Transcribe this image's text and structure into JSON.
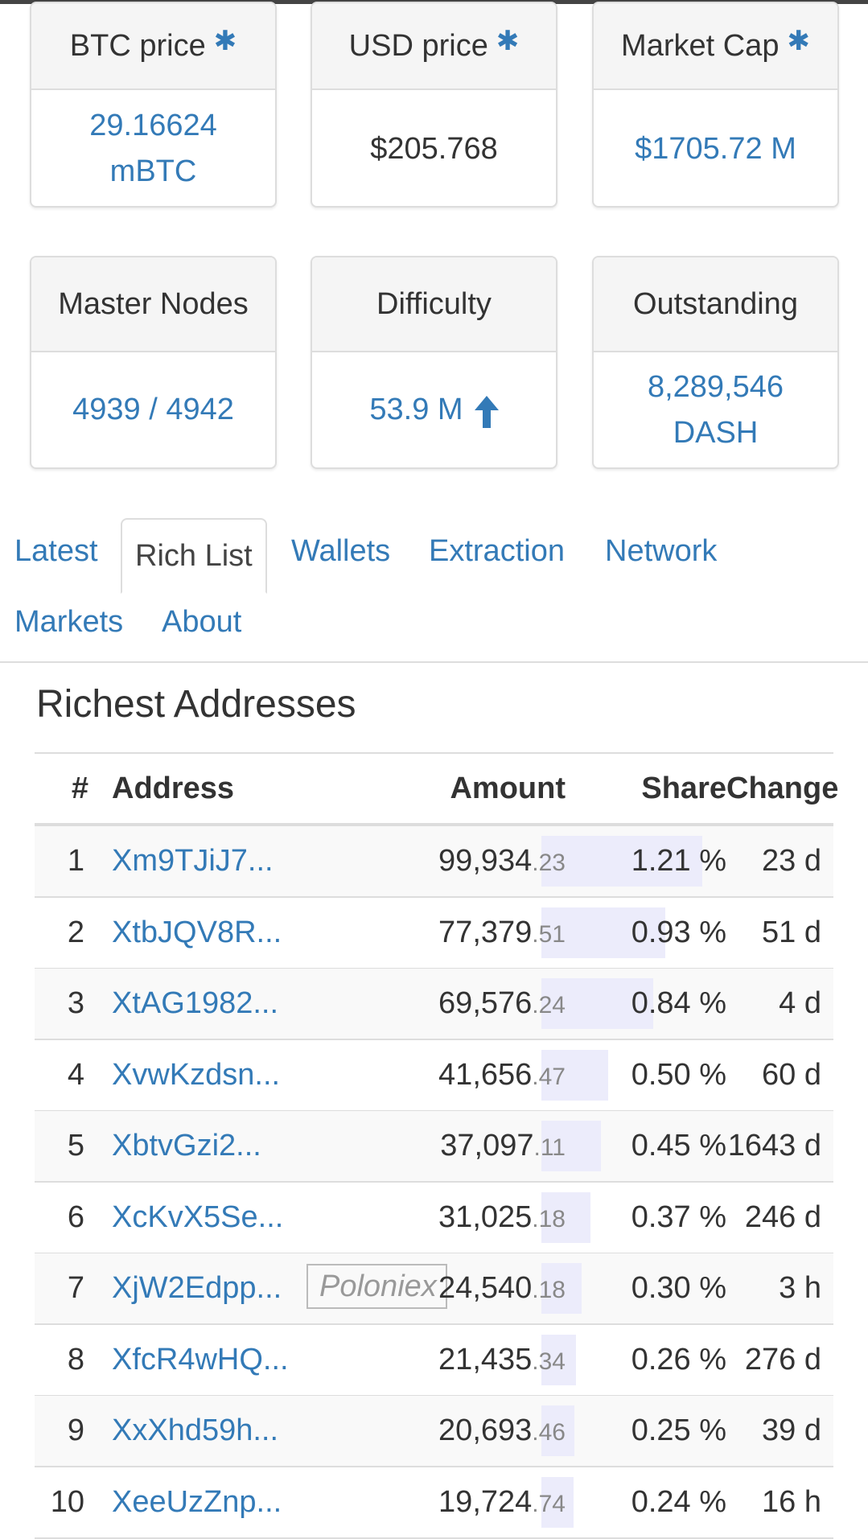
{
  "panels": [
    {
      "title": "BTC price",
      "star": "✱",
      "value": "29.16624\nmBTC",
      "value_line1": "29.16624",
      "value_line2": "mBTC"
    },
    {
      "title": "USD price",
      "star": "✱",
      "value": "$205.768"
    },
    {
      "title": "Market Cap",
      "star": "✱",
      "value": "$1705.72 M"
    },
    {
      "title": "Master Nodes",
      "value": "4939 / 4942"
    },
    {
      "title": "Difficulty",
      "value": "53.9 M",
      "trend_icon": "arrow-up-icon"
    },
    {
      "title": "Outstanding",
      "value_line1": "8,289,546",
      "value_line2": "DASH"
    }
  ],
  "tabs": [
    "Latest",
    "Rich List",
    "Wallets",
    "Extraction",
    "Network",
    "Markets",
    "About"
  ],
  "active_tab": "Rich List",
  "section_title": "Richest Addresses",
  "table": {
    "headers": [
      "#",
      "Address",
      "Amount",
      "Share",
      "Change"
    ],
    "rows": [
      {
        "num": "1",
        "address": "Xm9TJiJ7...",
        "amount_int": "99,934",
        "amount_dec": ".23",
        "share": "1.21 %",
        "share_value": 1.21,
        "change": "23 d"
      },
      {
        "num": "2",
        "address": "XtbJQV8R...",
        "amount_int": "77,379",
        "amount_dec": ".51",
        "share": "0.93 %",
        "share_value": 0.93,
        "change": "51 d"
      },
      {
        "num": "3",
        "address": "XtAG1982...",
        "amount_int": "69,576",
        "amount_dec": ".24",
        "share": "0.84 %",
        "share_value": 0.84,
        "change": "4 d"
      },
      {
        "num": "4",
        "address": "XvwKzdsn...",
        "amount_int": "41,656",
        "amount_dec": ".47",
        "share": "0.50 %",
        "share_value": 0.5,
        "change": "60 d"
      },
      {
        "num": "5",
        "address": "XbtvGzi2...",
        "amount_int": "37,097",
        "amount_dec": ".11",
        "share": "0.45 %",
        "share_value": 0.45,
        "change": "1643 d"
      },
      {
        "num": "6",
        "address": "XcKvX5Se...",
        "amount_int": "31,025",
        "amount_dec": ".18",
        "share": "0.37 %",
        "share_value": 0.37,
        "change": "246 d"
      },
      {
        "num": "7",
        "address": "XjW2Edpp...",
        "tag": "Poloniex",
        "amount_int": "24,540",
        "amount_dec": ".18",
        "share": "0.30 %",
        "share_value": 0.3,
        "change": "3 h"
      },
      {
        "num": "8",
        "address": "XfcR4wHQ...",
        "amount_int": "21,435",
        "amount_dec": ".34",
        "share": "0.26 %",
        "share_value": 0.26,
        "change": "276 d"
      },
      {
        "num": "9",
        "address": "XxXhd59h...",
        "amount_int": "20,693",
        "amount_dec": ".46",
        "share": "0.25 %",
        "share_value": 0.25,
        "change": "39 d"
      },
      {
        "num": "10",
        "address": "XeeUzZnp...",
        "amount_int": "19,724",
        "amount_dec": ".74",
        "share": "0.24 %",
        "share_value": 0.24,
        "change": "16 h"
      }
    ]
  },
  "colors": {
    "link": "#337ab7",
    "share_bar": "#ececfb"
  }
}
